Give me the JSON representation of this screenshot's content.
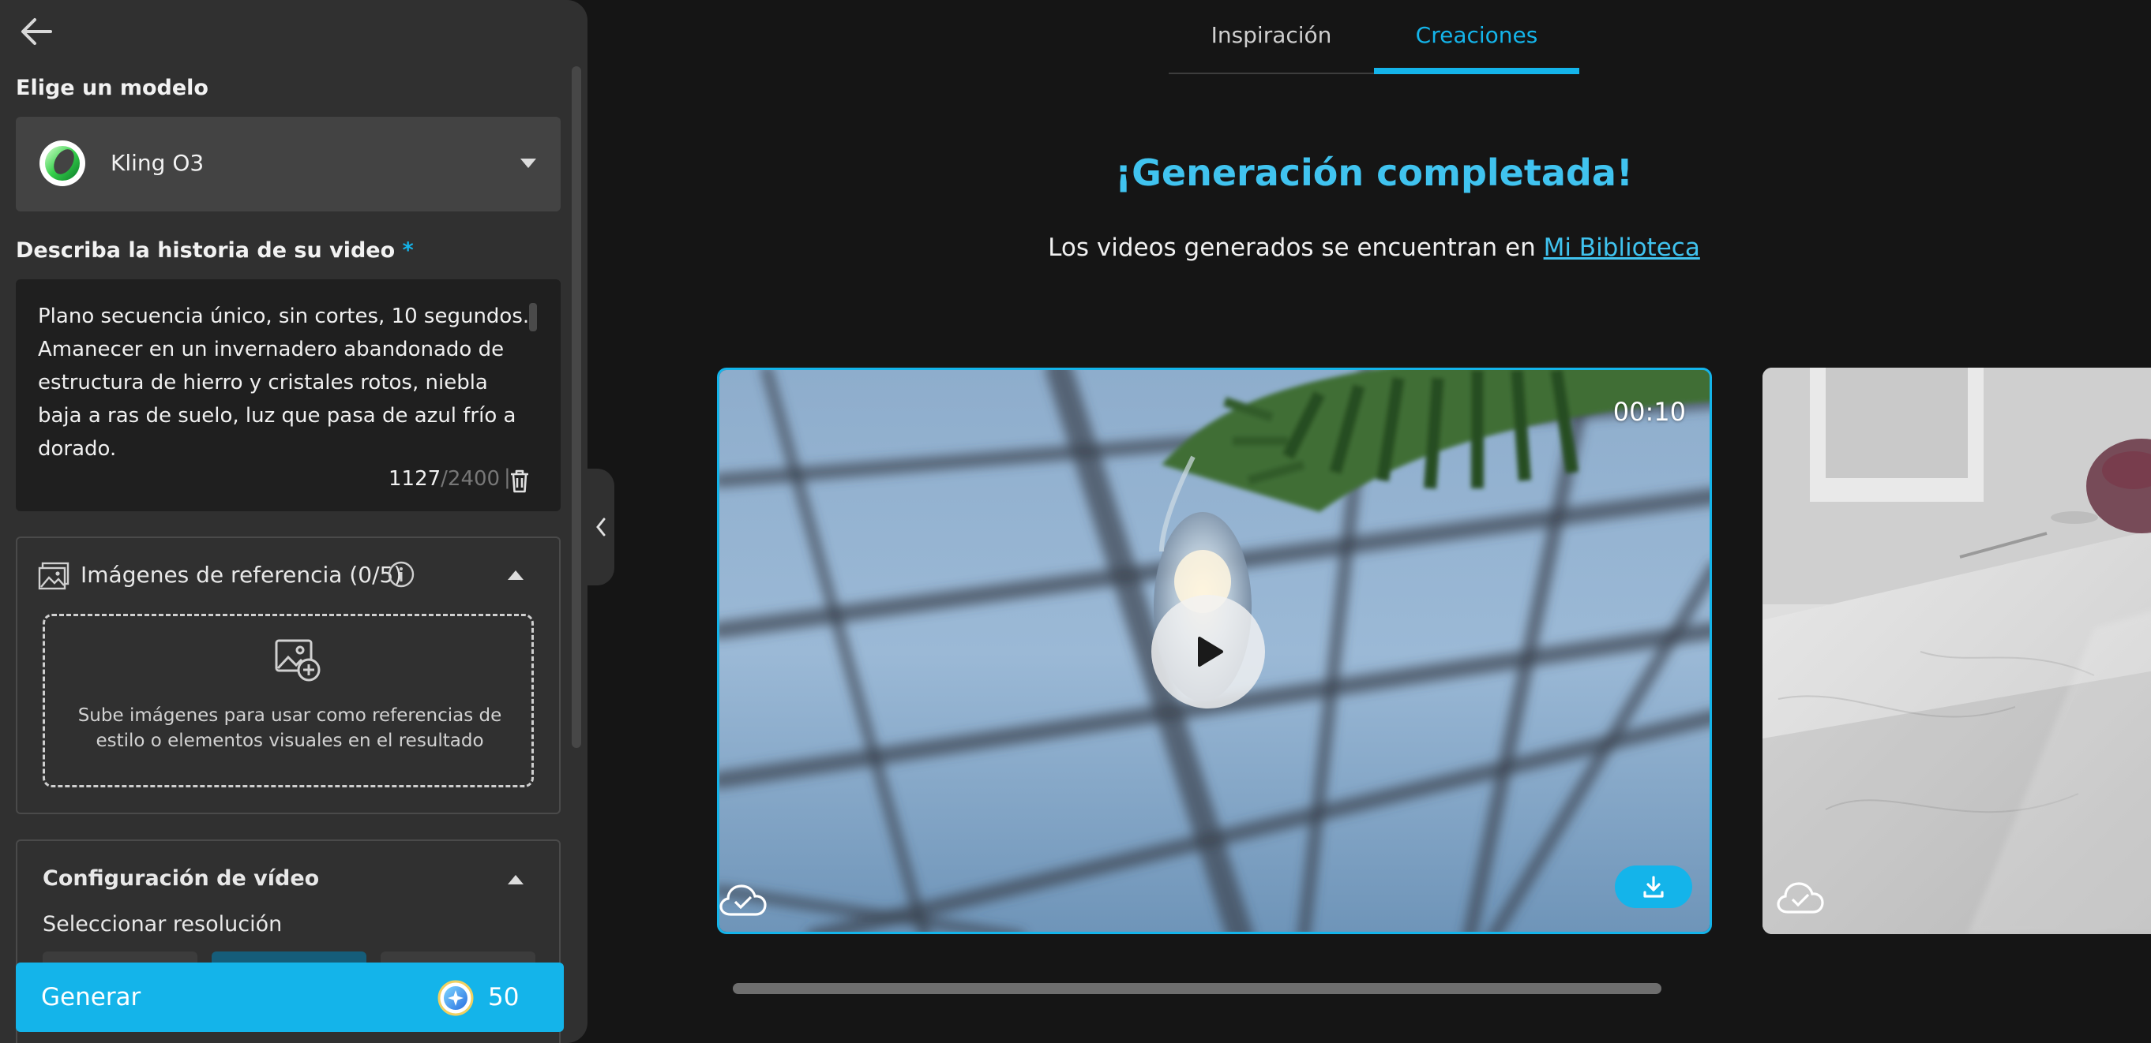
{
  "sidebar": {
    "model_section_label": "Elige un modelo",
    "model": {
      "name": "Kling O3"
    },
    "prompt_section_label": "Describa la historia de su video",
    "required_mark": "*",
    "prompt": {
      "text": "Plano secuencia único, sin cortes, 10 segundos. Amanecer en un invernadero abandonado de estructura de hierro y cristales rotos, niebla baja a ras de suelo, luz que pasa de azul frío a dorado.",
      "char_count": "1127",
      "char_max": "/2400",
      "separator": "|"
    },
    "reference_images": {
      "title": "Imágenes de referencia (0/5)",
      "dropzone_text": "Sube imágenes para usar como referencias de estilo o elementos visuales en el resultado"
    },
    "video_config": {
      "title": "Configuración de vídeo",
      "resolution_label": "Seleccionar resolución"
    },
    "generate": {
      "label": "Generar",
      "cost": "50"
    }
  },
  "main": {
    "tabs": [
      {
        "label": "Inspiración",
        "active": false
      },
      {
        "label": "Creaciones",
        "active": true
      }
    ],
    "headline": "¡Generación completada!",
    "subline_prefix": "Los videos generados se encuentran en ",
    "library_link": "Mi Biblioteca",
    "videos": [
      {
        "duration": "00:10",
        "selected": true
      }
    ]
  },
  "colors": {
    "accent": "#14b4ea",
    "panel_bg": "#303030",
    "page_bg": "#151515"
  },
  "icons": [
    "back-arrow-icon",
    "chevron-down-icon",
    "trash-icon",
    "image-gallery-icon",
    "info-icon",
    "chevron-up-icon",
    "add-image-icon",
    "credit-icon",
    "chevron-left-icon",
    "play-icon",
    "cloud-check-icon",
    "download-icon"
  ]
}
